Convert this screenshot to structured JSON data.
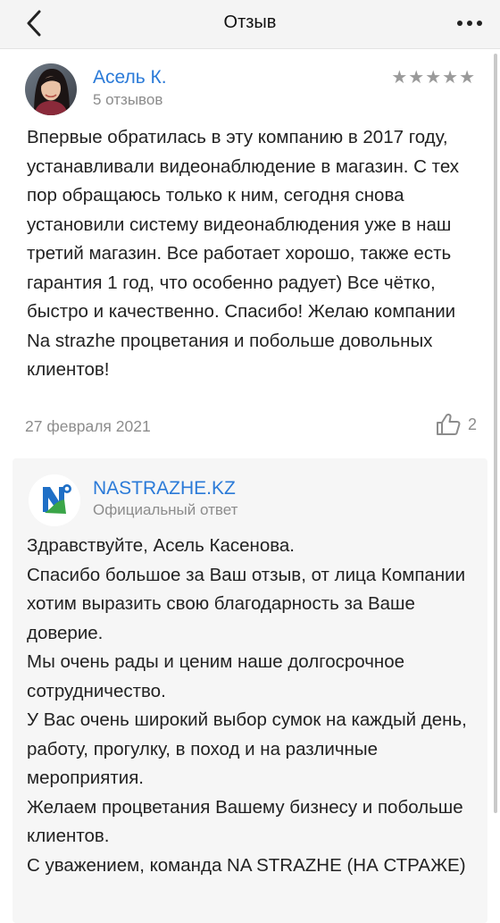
{
  "nav": {
    "title": "Отзыв",
    "back_icon": "chevron-left-icon",
    "more_icon": "more-horizontal-icon"
  },
  "review": {
    "author_name": "Асель К.",
    "author_reviews_count": "5 отзывов",
    "rating": 5,
    "rating_max": 5,
    "text": "Впервые обратилась в эту компанию в 2017 году, устанавливали видеонаблюдение в магазин. С тех пор обращаюсь только к ним, сегодня снова установили систему видеонаблюдения уже в наш третий магазин. Все работает хорошо, также есть гарантия 1 год, что особенно радует) Все чётко, быстро и качественно. Спасибо! Желаю компании Na strazhe процветания и побольше довольных клиентов!",
    "date": "27 февраля 2021",
    "likes_count": "2"
  },
  "reply": {
    "company_name": "NASTRAZHE.KZ",
    "label": "Официальный ответ",
    "lines": [
      "Здравствуйте, Асель Касенова.",
      "Спасибо большое за Ваш отзыв, от лица Компании хотим выразить свою благодарность за Ваше доверие.",
      "Мы очень рады и ценим наше долгосрочное сотрудничество.",
      "У Вас очень широкий выбор сумок на каждый день, работу, прогулку, в поход и на различные мероприятия.",
      "Желаем процветания Вашему бизнесу и побольше клиентов.",
      "С уважением, команда NA STRAZHE (НА СТРАЖЕ)"
    ]
  },
  "colors": {
    "link_blue": "#2a7ad8",
    "secondary_gray": "#8c8c8c",
    "star_gray": "#9a9a9a",
    "logo_blue": "#1f6fc6",
    "logo_green": "#3aa548"
  }
}
